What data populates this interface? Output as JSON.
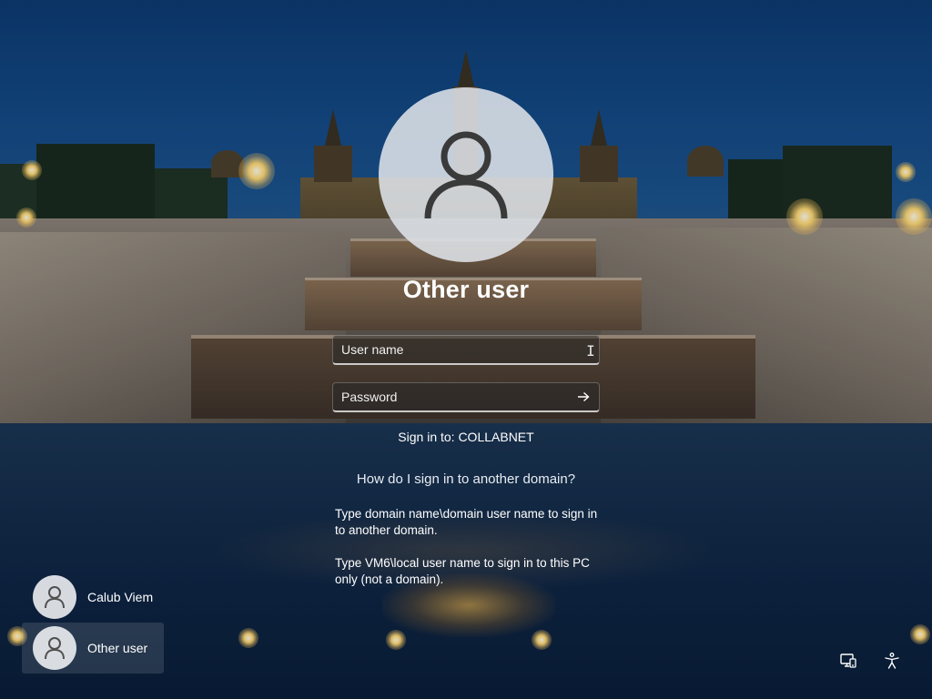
{
  "login": {
    "user_title": "Other user",
    "username_placeholder": "User name",
    "password_placeholder": "Password",
    "sign_in_to": "Sign in to: COLLABNET",
    "help_link": "How do I sign in to another domain?",
    "help_paragraph_1": "Type domain name\\domain user name to sign in to another domain.",
    "help_paragraph_2": "Type VM6\\local user name to sign in to this PC only (not a domain)."
  },
  "user_list": [
    {
      "name": "Calub Viem",
      "selected": false,
      "icon": "user-avatar-icon"
    },
    {
      "name": "Other user",
      "selected": true,
      "icon": "user-avatar-icon"
    }
  ],
  "corner_icons": [
    {
      "name": "network-icon"
    },
    {
      "name": "accessibility-icon"
    }
  ],
  "colors": {
    "field_bg": "#282828",
    "avatar_bg": "#dee2e8",
    "text": "#ffffff"
  }
}
